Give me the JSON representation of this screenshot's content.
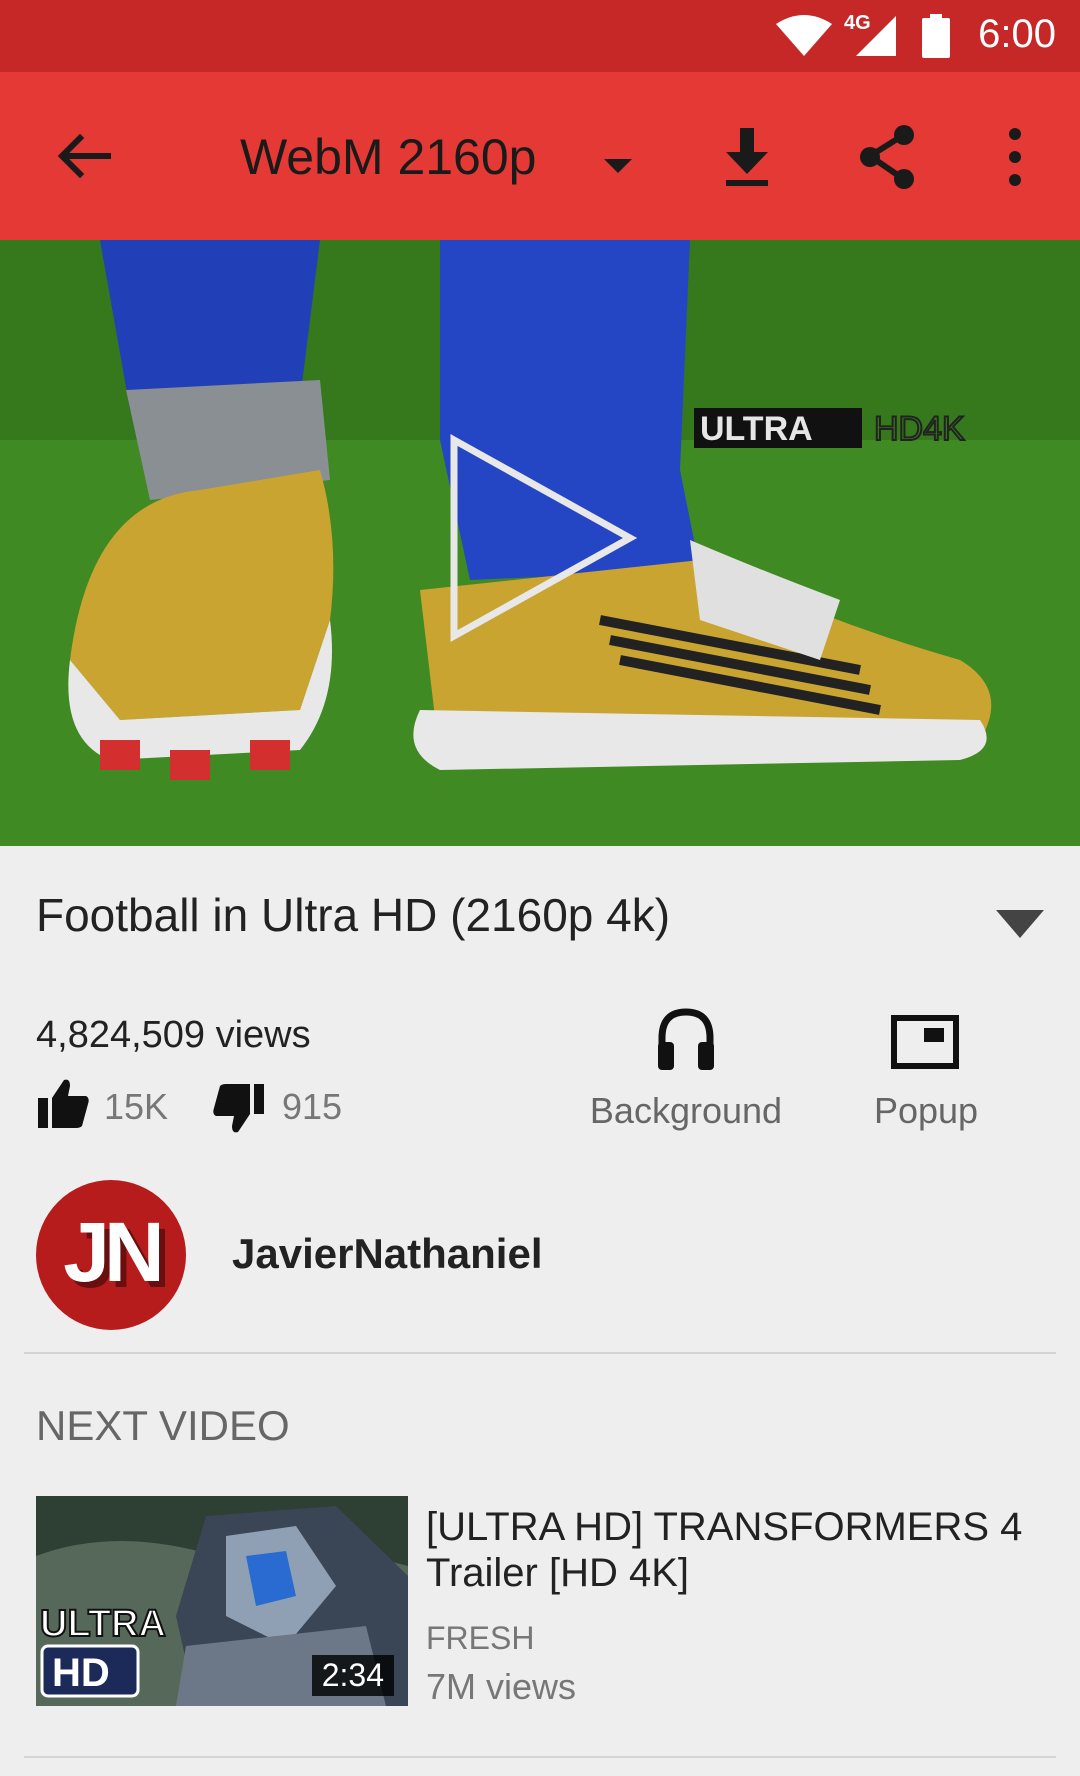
{
  "status_bar": {
    "time": "6:00",
    "network": "4G",
    "icons": [
      "wifi-icon",
      "signal-icon",
      "battery-icon"
    ]
  },
  "toolbar": {
    "quality": "WebM 2160p",
    "icons": [
      "back-arrow-icon",
      "dropdown-arrow-icon",
      "download-icon",
      "share-icon",
      "more-vert-icon"
    ]
  },
  "video": {
    "overlay_text_1": "ULTRA",
    "overlay_text_2": "HD4K",
    "play_icon": "play-icon"
  },
  "details": {
    "title": "Football in Ultra HD (2160p 4k)",
    "views": "4,824,509 views",
    "likes": "15K",
    "dislikes": "915",
    "background_label": "Background",
    "popup_label": "Popup"
  },
  "channel": {
    "avatar_letters": "JN",
    "name": "JavierNathaniel"
  },
  "next_video": {
    "section_label": "NEXT VIDEO",
    "title": "[ULTRA HD] TRANSFORMERS 4 Trailer [HD 4K]",
    "channel": "FRESH",
    "views": "7M views",
    "duration": "2:34",
    "thumb_text_1": "ULTRA",
    "thumb_text_2": "HD"
  },
  "colors": {
    "status_bar": "#c62828",
    "app_bar": "#e53935",
    "background": "#eeeeee"
  }
}
